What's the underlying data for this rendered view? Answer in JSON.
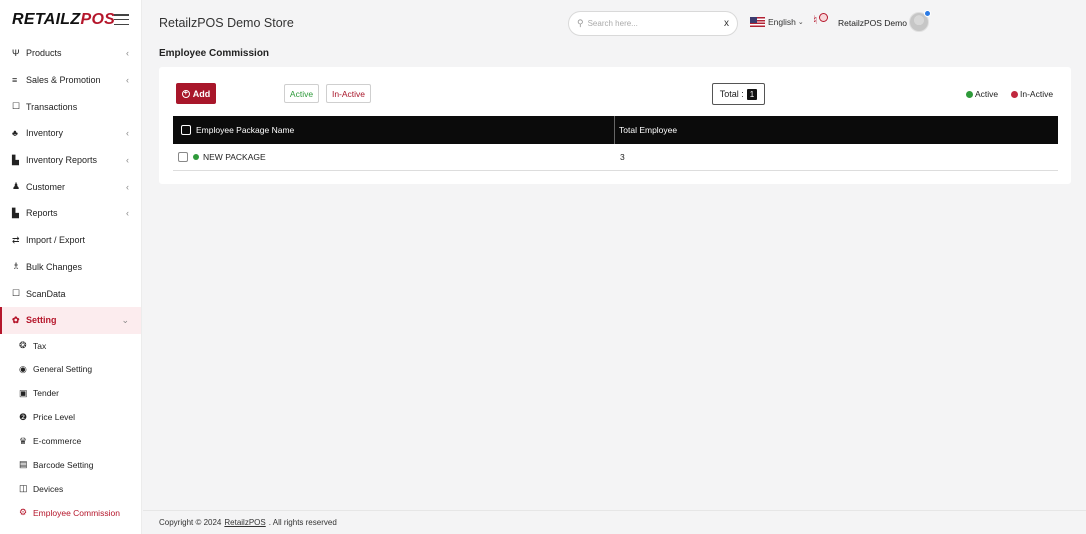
{
  "brand": {
    "logo_main": "RETAILZ",
    "logo_accent": "POS",
    "accent_color": "#b5162b"
  },
  "sidebar": {
    "items": [
      {
        "label": "Products",
        "icon": "utensils-icon",
        "glyph": "Ψ",
        "chevron": "‹"
      },
      {
        "label": "Sales & Promotion",
        "icon": "list-icon",
        "glyph": "≡",
        "chevron": "‹"
      },
      {
        "label": "Transactions",
        "icon": "window-icon",
        "glyph": "☐",
        "chevron": ""
      },
      {
        "label": "Inventory",
        "icon": "cubes-icon",
        "glyph": "♣",
        "chevron": "‹"
      },
      {
        "label": "Inventory Reports",
        "icon": "file-icon",
        "glyph": "▙",
        "chevron": "‹"
      },
      {
        "label": "Customer",
        "icon": "user-icon",
        "glyph": "♟",
        "chevron": "‹"
      },
      {
        "label": "Reports",
        "icon": "report-icon",
        "glyph": "▙",
        "chevron": "‹"
      },
      {
        "label": "Import / Export",
        "icon": "transfer-icon",
        "glyph": "⇄",
        "chevron": ""
      },
      {
        "label": "Bulk Changes",
        "icon": "sitemap-icon",
        "glyph": "♗",
        "chevron": ""
      },
      {
        "label": "ScanData",
        "icon": "window-icon",
        "glyph": "☐",
        "chevron": ""
      },
      {
        "label": "Setting",
        "icon": "gear-icon",
        "glyph": "✿",
        "chevron": "⌄"
      }
    ],
    "setting_submenu": [
      {
        "label": "Tax",
        "icon": "tax-icon",
        "glyph": "❂"
      },
      {
        "label": "General Setting",
        "icon": "target-icon",
        "glyph": "◉"
      },
      {
        "label": "Tender",
        "icon": "money-icon",
        "glyph": "▣"
      },
      {
        "label": "Price Level",
        "icon": "dollar-icon",
        "glyph": "❷"
      },
      {
        "label": "E-commerce",
        "icon": "basket-icon",
        "glyph": "♛"
      },
      {
        "label": "Barcode Setting",
        "icon": "barcode-icon",
        "glyph": "▤"
      },
      {
        "label": "Devices",
        "icon": "devices-icon",
        "glyph": "◫"
      },
      {
        "label": "Employee Commission",
        "icon": "gear-outline-icon",
        "glyph": "⚙"
      }
    ]
  },
  "header": {
    "store_name": "RetailzPOS Demo Store",
    "search_placeholder": "Search here...",
    "search_clear": "x",
    "language": "English",
    "user_name": "RetailzPOS Demo"
  },
  "page": {
    "title": "Employee Commission",
    "add_label": "Add",
    "filter_active": "Active",
    "filter_inactive": "In-Active",
    "total_label": "Total :",
    "total_count": "1",
    "legend_active": "Active",
    "legend_inactive": "In-Active",
    "active_color": "#2e9a3a",
    "inactive_color": "#c0283e"
  },
  "table": {
    "columns": [
      "Employee Package Name",
      "Total Employee"
    ],
    "rows": [
      {
        "name": "NEW PACKAGE",
        "total": "3",
        "status": "active"
      }
    ]
  },
  "footer": {
    "prefix": "Copyright © 2024",
    "link": "RetailzPOS",
    "suffix": ". All rights reserved"
  }
}
